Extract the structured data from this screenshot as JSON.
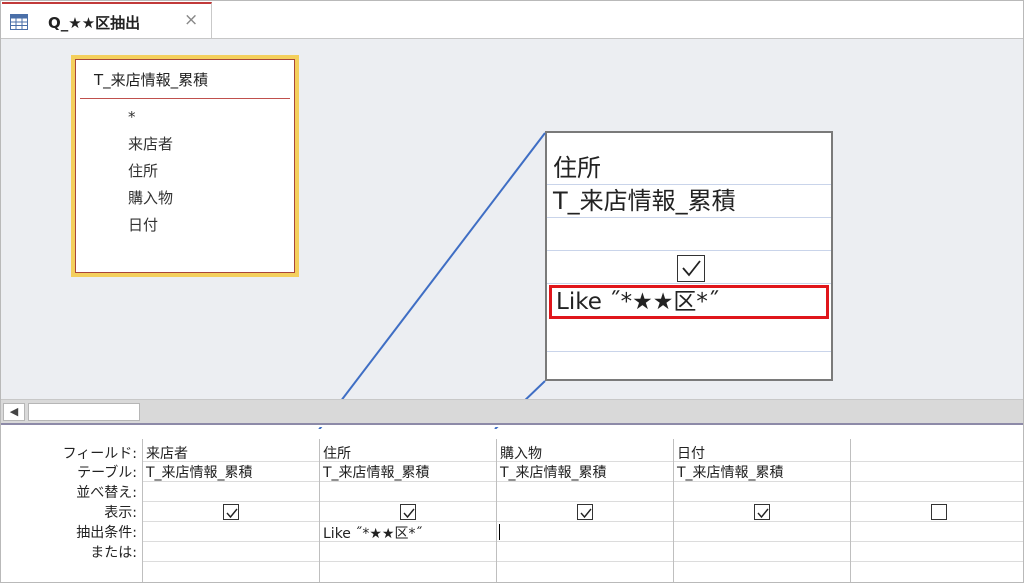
{
  "tab": {
    "title": "Q_★★区抽出",
    "close_glyph": "×"
  },
  "table_box": {
    "title": "T_来店情報_累積",
    "fields": [
      "*",
      "来店者",
      "住所",
      "購入物",
      "日付"
    ]
  },
  "callout": {
    "field": "住所",
    "table": "T_来店情報_累積",
    "criteria": "Like ˝*★★区*˝",
    "highlight_color": "#e0161b"
  },
  "scroll": {
    "left_arrow": "◀"
  },
  "grid": {
    "row_labels": [
      "フィールド:",
      "テーブル:",
      "並べ替え:",
      "表示:",
      "抽出条件:",
      "または:"
    ],
    "columns": [
      {
        "field": "来店者",
        "table": "T_来店情報_累積",
        "sort": "",
        "show": true,
        "criteria": "",
        "or": ""
      },
      {
        "field": "住所",
        "table": "T_来店情報_累積",
        "sort": "",
        "show": true,
        "criteria": "Like ˝*★★区*˝",
        "or": ""
      },
      {
        "field": "購入物",
        "table": "T_来店情報_累積",
        "sort": "",
        "show": true,
        "criteria": "",
        "or": ""
      },
      {
        "field": "日付",
        "table": "T_来店情報_累積",
        "sort": "",
        "show": true,
        "criteria": "",
        "or": ""
      },
      {
        "field": "",
        "table": "",
        "sort": "",
        "show": false,
        "criteria": "",
        "or": ""
      }
    ]
  },
  "colors": {
    "tab_accent": "#c13a3a",
    "table_box_border": "#f4cf5c",
    "zoom_line": "#3f6ec4"
  }
}
